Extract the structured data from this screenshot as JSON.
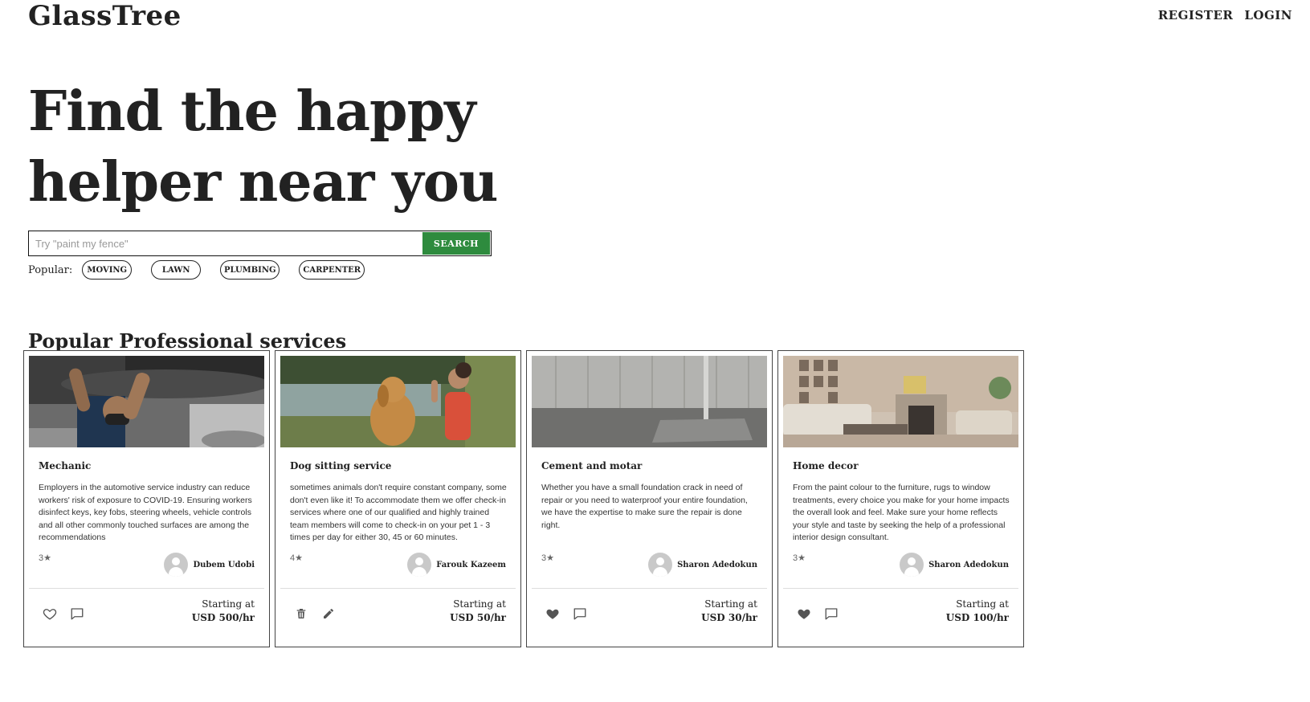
{
  "header": {
    "logo": "GlassTree",
    "nav": [
      "REGISTER",
      "LOGIN"
    ]
  },
  "hero": {
    "title": "Find the happy helper near you"
  },
  "search": {
    "placeholder": "Try \"paint my fence\"",
    "button_label": "SEARCH"
  },
  "popular": {
    "label": "Popular:",
    "tags": [
      "MOVING",
      "LAWN",
      "PLUMBING",
      "CARPENTER"
    ]
  },
  "section": {
    "title": "Popular Professional services"
  },
  "cards": [
    {
      "title": "Mechanic",
      "description": "Employers in the automotive service industry can reduce workers' risk of exposure to COVID-19. Ensuring workers disinfect keys, key fobs, steering wheels, vehicle controls and all other commonly touched surfaces are among the recommendations",
      "rating": "3★",
      "author": "Dubem Udobi",
      "price_label": "Starting at",
      "price": "USD 500/hr",
      "actions": [
        "heart-outline-icon",
        "comment-icon"
      ]
    },
    {
      "title": "Dog sitting service",
      "description": "sometimes animals don't require constant company, some don't even like it! To accommodate them we offer check-in services where one of our qualified and highly trained team members will come to check-in on your pet 1 - 3 times per day for either 30, 45 or 60 minutes.",
      "rating": "4★",
      "author": "Farouk Kazeem",
      "price_label": "Starting at",
      "price": "USD 50/hr",
      "actions": [
        "trash-icon",
        "pencil-icon"
      ]
    },
    {
      "title": "Cement and motar",
      "description": "Whether you have a small foundation crack in need of repair or you need to waterproof your entire foundation, we have the expertise to make sure the repair is done right.",
      "rating": "3★",
      "author": "Sharon Adedokun",
      "price_label": "Starting at",
      "price": "USD 30/hr",
      "actions": [
        "heart-filled-icon",
        "comment-icon"
      ]
    },
    {
      "title": "Home decor",
      "description": "From the paint colour to the furniture, rugs to window treatments, every choice you make for your home impacts the overall look and feel. Make sure your home reflects your style and taste by seeking the help of a professional interior design consultant.",
      "rating": "3★",
      "author": "Sharon Adedokun",
      "price_label": "Starting at",
      "price": "USD 100/hr",
      "actions": [
        "heart-filled-icon",
        "comment-icon"
      ]
    }
  ]
}
